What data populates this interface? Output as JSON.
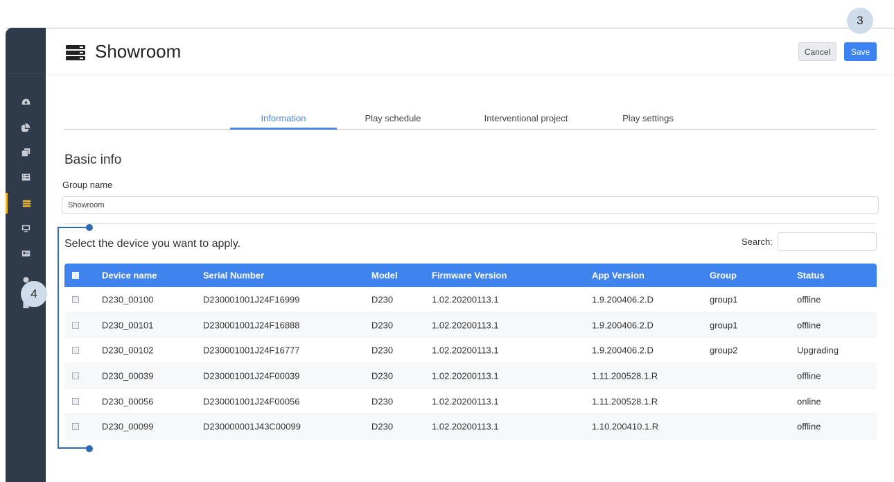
{
  "header": {
    "title": "Showroom",
    "cancel_label": "Cancel",
    "save_label": "Save"
  },
  "callouts": {
    "save": "3",
    "table": "4"
  },
  "sidebar": {
    "items": [
      {
        "icon": "dashboard-icon"
      },
      {
        "icon": "pie-chart-icon"
      },
      {
        "icon": "layers-icon"
      },
      {
        "icon": "list-icon"
      },
      {
        "icon": "groups-icon",
        "active": true
      },
      {
        "icon": "monitor-icon"
      },
      {
        "icon": "id-card-icon"
      },
      {
        "icon": "settings-icon"
      },
      {
        "icon": "clipboard-icon"
      }
    ]
  },
  "tabs": [
    {
      "label": "Information",
      "active": true
    },
    {
      "label": "Play schedule"
    },
    {
      "label": "Interventional project"
    },
    {
      "label": "Play settings"
    }
  ],
  "basic_info": {
    "title": "Basic info",
    "group_name_label": "Group name",
    "group_name_value": "Showroom"
  },
  "devices": {
    "instruction": "Select the device you want to apply.",
    "search_label": "Search:",
    "columns": [
      "Device name",
      "Serial Number",
      "Model",
      "Firmware Version",
      "App Version",
      "Group",
      "Status"
    ],
    "rows": [
      [
        "D230_00100",
        "D230001001J24F16999",
        "D230",
        "1.02.20200113.1",
        "1.9.200406.2.D",
        "group1",
        "offline"
      ],
      [
        "D230_00101",
        "D230001001J24F16888",
        "D230",
        "1.02.20200113.1",
        "1.9.200406.2.D",
        "group1",
        "offline"
      ],
      [
        "D230_00102",
        "D230001001J24F16777",
        "D230",
        "1.02.20200113.1",
        "1.9.200406.2.D",
        "group2",
        "Upgrading"
      ],
      [
        "D230_00039",
        "D230001001J24F00039",
        "D230",
        "1.02.20200113.1",
        "1.11.200528.1.R",
        "",
        "offline"
      ],
      [
        "D230_00056",
        "D230001001J24F00056",
        "D230",
        "1.02.20200113.1",
        "1.11.200528.1.R",
        "",
        "online"
      ],
      [
        "D230_00099",
        "D230000001J43C00099",
        "D230",
        "1.02.20200113.1",
        "1.10.200410.1.R",
        "",
        "offline"
      ]
    ]
  },
  "colors": {
    "accent": "#3f83ee",
    "sidebar": "#2f3a4a",
    "active_nav": "#f0b429"
  }
}
